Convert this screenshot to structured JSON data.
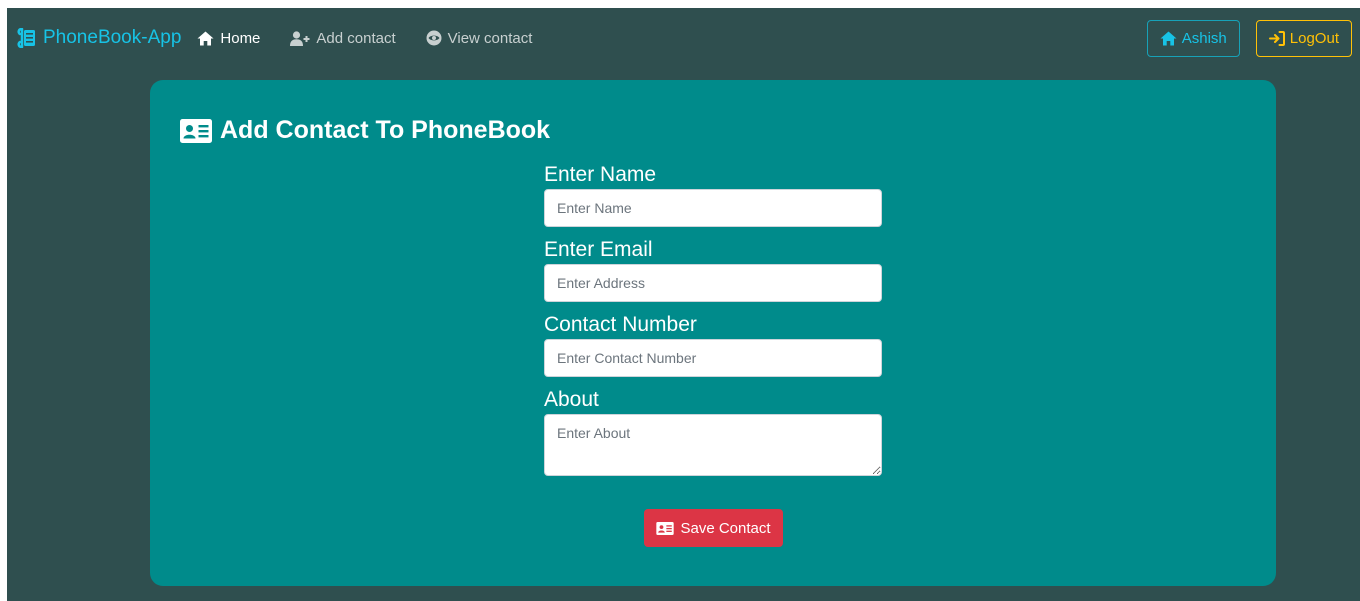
{
  "navbar": {
    "brand": "PhoneBook-App",
    "links": [
      {
        "label": "Home",
        "icon": "home-icon",
        "active": true
      },
      {
        "label": "Add contact",
        "icon": "user-plus-icon",
        "active": false
      },
      {
        "label": "View contact",
        "icon": "eye-icon",
        "active": false
      }
    ],
    "user_button": "Ashish",
    "logout_button": "LogOut"
  },
  "card": {
    "title": "Add Contact To PhoneBook",
    "fields": {
      "name": {
        "label": "Enter Name",
        "placeholder": "Enter Name",
        "value": ""
      },
      "email": {
        "label": "Enter Email",
        "placeholder": "Enter Address",
        "value": ""
      },
      "phone": {
        "label": "Contact Number",
        "placeholder": "Enter Contact Number",
        "value": ""
      },
      "about": {
        "label": "About",
        "placeholder": "Enter About",
        "value": ""
      }
    },
    "save_button": "Save Contact"
  },
  "colors": {
    "page_bg": "#2f4f4f",
    "card_bg": "#008b8b",
    "brand": "#17c3e6",
    "user_button_border": "#17a2b8",
    "logout_accent": "#ffc107",
    "save_button_bg": "#dc3545"
  }
}
